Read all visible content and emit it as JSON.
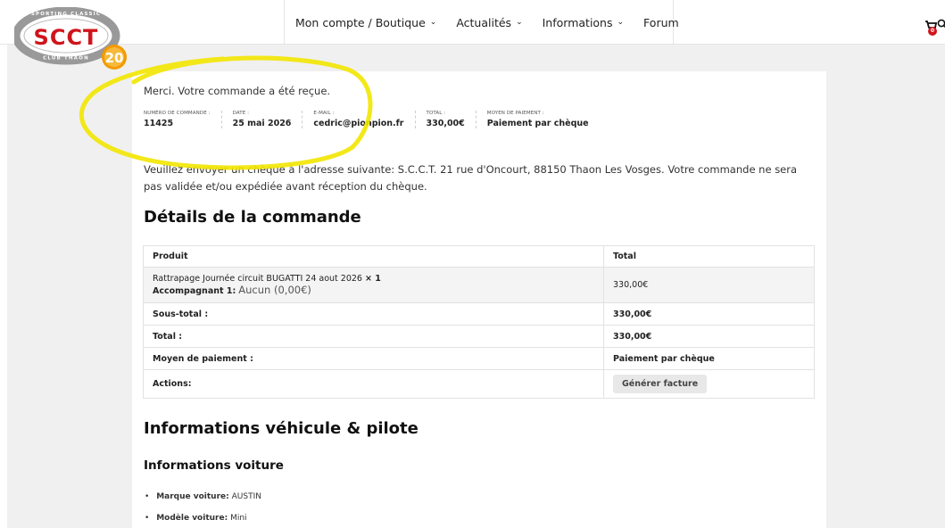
{
  "header": {
    "logo_text": "SCCT",
    "logo_ring_top": "SPORTING CLASSIC",
    "logo_ring_bottom": "CLUB THAON",
    "logo_badge": "20",
    "nav": [
      {
        "label": "Mon compte / Boutique",
        "chevron": true
      },
      {
        "label": "Actualités",
        "chevron": true
      },
      {
        "label": "Informations",
        "chevron": true
      },
      {
        "label": "Forum",
        "chevron": false
      }
    ],
    "cart_count": "0",
    "chevron_glyph": "⌄"
  },
  "order": {
    "thanks": "Merci. Votre commande a été reçue.",
    "overview": [
      {
        "label": "NUMÉRO DE COMMANDE :",
        "value": "11425"
      },
      {
        "label": "DATE :",
        "value": "25 mai 2026"
      },
      {
        "label": "E-MAIL :",
        "value": "cedric@pionpion.fr"
      },
      {
        "label": "TOTAL :",
        "value": "330,00€"
      },
      {
        "label": "MOYEN DE PAIEMENT :",
        "value": "Paiement par chèque"
      }
    ],
    "instructions": "Veuillez envoyer un chèque à l'adresse suivante: S.C.C.T. 21 rue d'Oncourt, 88150 Thaon Les Vosges. Votre commande ne sera pas validée et/ou expédiée avant réception du chèque."
  },
  "details": {
    "title": "Détails de la commande",
    "headers": {
      "product": "Produit",
      "total": "Total"
    },
    "product": {
      "name": "Rattrapage Journée circuit BUGATTI 24 aout 2026",
      "qty": "× 1",
      "meta_label": "Accompagnant 1:",
      "meta_value": "Aucun (0,00€)",
      "total": "330,00€"
    },
    "rows": [
      {
        "label": "Sous-total :",
        "value": "330,00€"
      },
      {
        "label": "Total :",
        "value": "330,00€"
      },
      {
        "label": "Moyen de paiement :",
        "value": "Paiement par chèque"
      }
    ],
    "actions_label": "Actions:",
    "invoice_button": "Générer facture"
  },
  "vehicle": {
    "title": "Informations véhicule & pilote",
    "car_title": "Informations voiture",
    "fields": [
      {
        "label": "Marque voiture:",
        "value": "AUSTIN"
      },
      {
        "label": "Modèle voiture:",
        "value": "Mini"
      }
    ]
  },
  "colors": {
    "highlight": "#f2e600",
    "logo_red": "#d0141b",
    "badge_orange": "#f29a00",
    "cart_badge": "#d0141b"
  },
  "icons": [
    "cart-icon",
    "search-icon",
    "chevron-down-icon"
  ]
}
